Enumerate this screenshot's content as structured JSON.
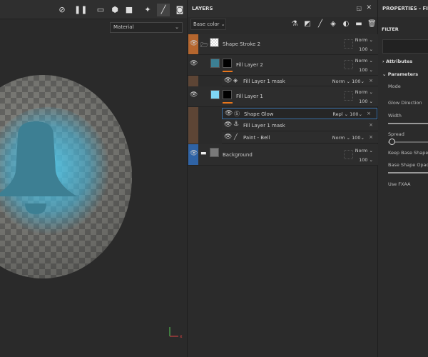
{
  "viewport": {
    "material_select": "Material",
    "toolbar": [
      "hide-icon",
      "pause-icon",
      "perspective-icon",
      "cube-icon",
      "camera-icon",
      "lights-icon",
      "paint-icon",
      "screenshot-icon"
    ]
  },
  "layers": {
    "title": "LAYERS",
    "channel": "Base color",
    "items": [
      {
        "name": "Shape Stroke 2",
        "blend": "Norm",
        "opacity": "100",
        "color": "#b5662e"
      },
      {
        "name": "Fill Layer 2",
        "blend": "Norm",
        "opacity": "100",
        "color": "#5d4535"
      },
      {
        "name": "Fill Layer 1 mask",
        "blend": "Norm",
        "opacity": "100"
      },
      {
        "name": "Fill Layer 1",
        "blend": "Norm",
        "opacity": "100",
        "color": "#5d4535"
      },
      {
        "name": "Shape Glow",
        "blend": "Repl",
        "opacity": "100"
      },
      {
        "name": "Fill Layer 1 mask"
      },
      {
        "name": "Paint - Bell",
        "blend": "Norm",
        "opacity": "100"
      },
      {
        "name": "Background",
        "blend": "Norm",
        "opacity": "100",
        "color": "#2f63a5"
      }
    ]
  },
  "properties": {
    "title": "PROPERTIES - FILTER",
    "filter_label": "FILTER",
    "attributes": "Attributes",
    "parameters": "Parameters",
    "params": [
      "Mode",
      "Glow Direction",
      "Width",
      "Spread",
      "Keep Base Shape",
      "Base Shape Opacity",
      "Use FXAA"
    ]
  }
}
